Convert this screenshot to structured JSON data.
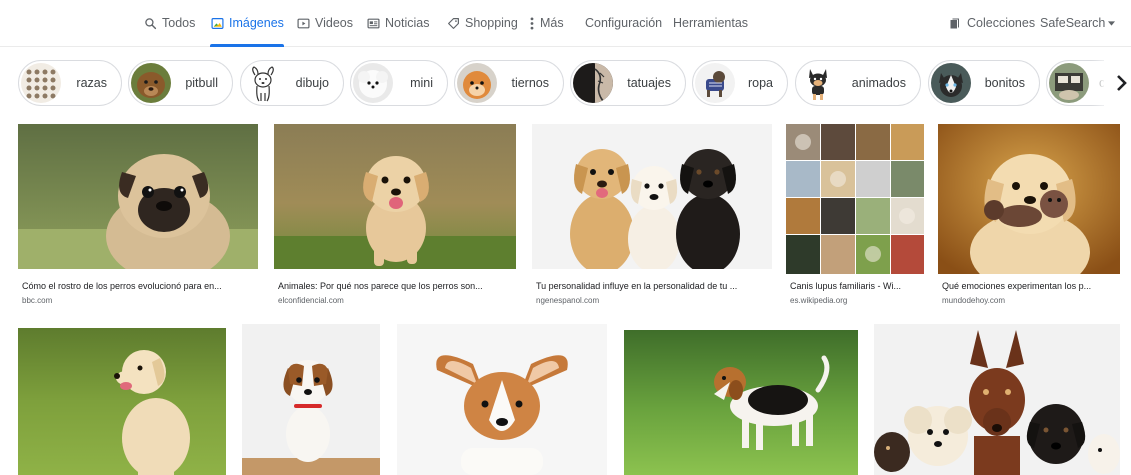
{
  "nav": {
    "todos": "Todos",
    "imagenes": "Imágenes",
    "videos": "Videos",
    "noticias": "Noticias",
    "shopping": "Shopping",
    "mas": "Más",
    "configuracion": "Configuración",
    "herramientas": "Herramientas",
    "colecciones": "Colecciones",
    "safesearch": "SafeSearch"
  },
  "chips": [
    "razas",
    "pitbull",
    "dibujo",
    "mini",
    "tiernos",
    "tatuajes",
    "ropa",
    "animados",
    "bonitos",
    "c"
  ],
  "results": [
    {
      "title": "Cómo el rostro de los perros evolucionó para en...",
      "source": "bbc.com"
    },
    {
      "title": "Animales: Por qué nos parece que los perros son...",
      "source": "elconfidencial.com"
    },
    {
      "title": "Tu personalidad influye en la personalidad de tu ...",
      "source": "ngenespanol.com"
    },
    {
      "title": "Canis lupus familiaris - Wi...",
      "source": "es.wikipedia.org"
    },
    {
      "title": "Qué emociones experimentan los p...",
      "source": "mundodehoy.com"
    }
  ],
  "colors": {
    "accent": "#1a73e8",
    "text": "#202124",
    "muted": "#5f6368",
    "border": "#dadce0"
  }
}
